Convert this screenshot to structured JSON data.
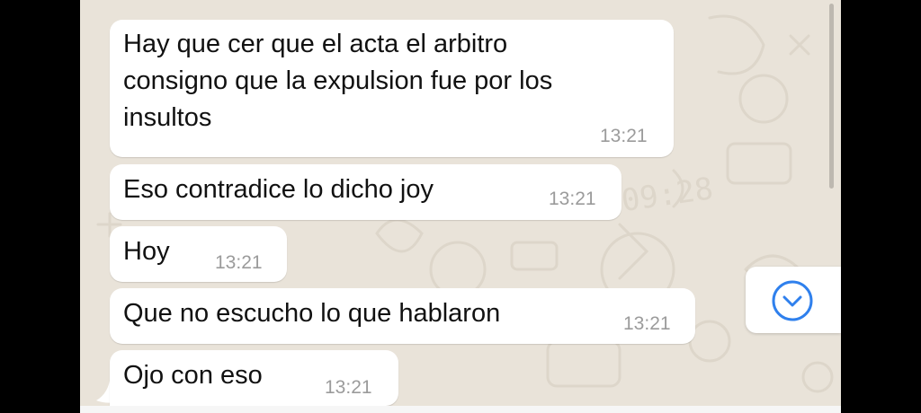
{
  "messages": [
    {
      "lines": [
        "Hay que cer que el acta el arbitro",
        "consigno que la expulsion fue por los",
        "insultos"
      ],
      "time": "13:21"
    },
    {
      "lines": [
        "Eso contradice lo dicho joy"
      ],
      "time": "13:21"
    },
    {
      "lines": [
        "Hoy"
      ],
      "time": "13:21"
    },
    {
      "lines": [
        "Que no escucho lo que hablaron"
      ],
      "time": "13:21"
    },
    {
      "lines": [
        "Ojo con eso"
      ],
      "time": "13:21"
    }
  ],
  "wallpaper": {
    "clock_text": "09:28"
  },
  "colors": {
    "wallpaper": "#e9e3d9",
    "bubble": "#ffffff",
    "timestamp": "#9b9b9b",
    "scroll_button_icon": "#2f80ed"
  },
  "icons": {
    "scroll_down": "chevron-down-icon"
  }
}
